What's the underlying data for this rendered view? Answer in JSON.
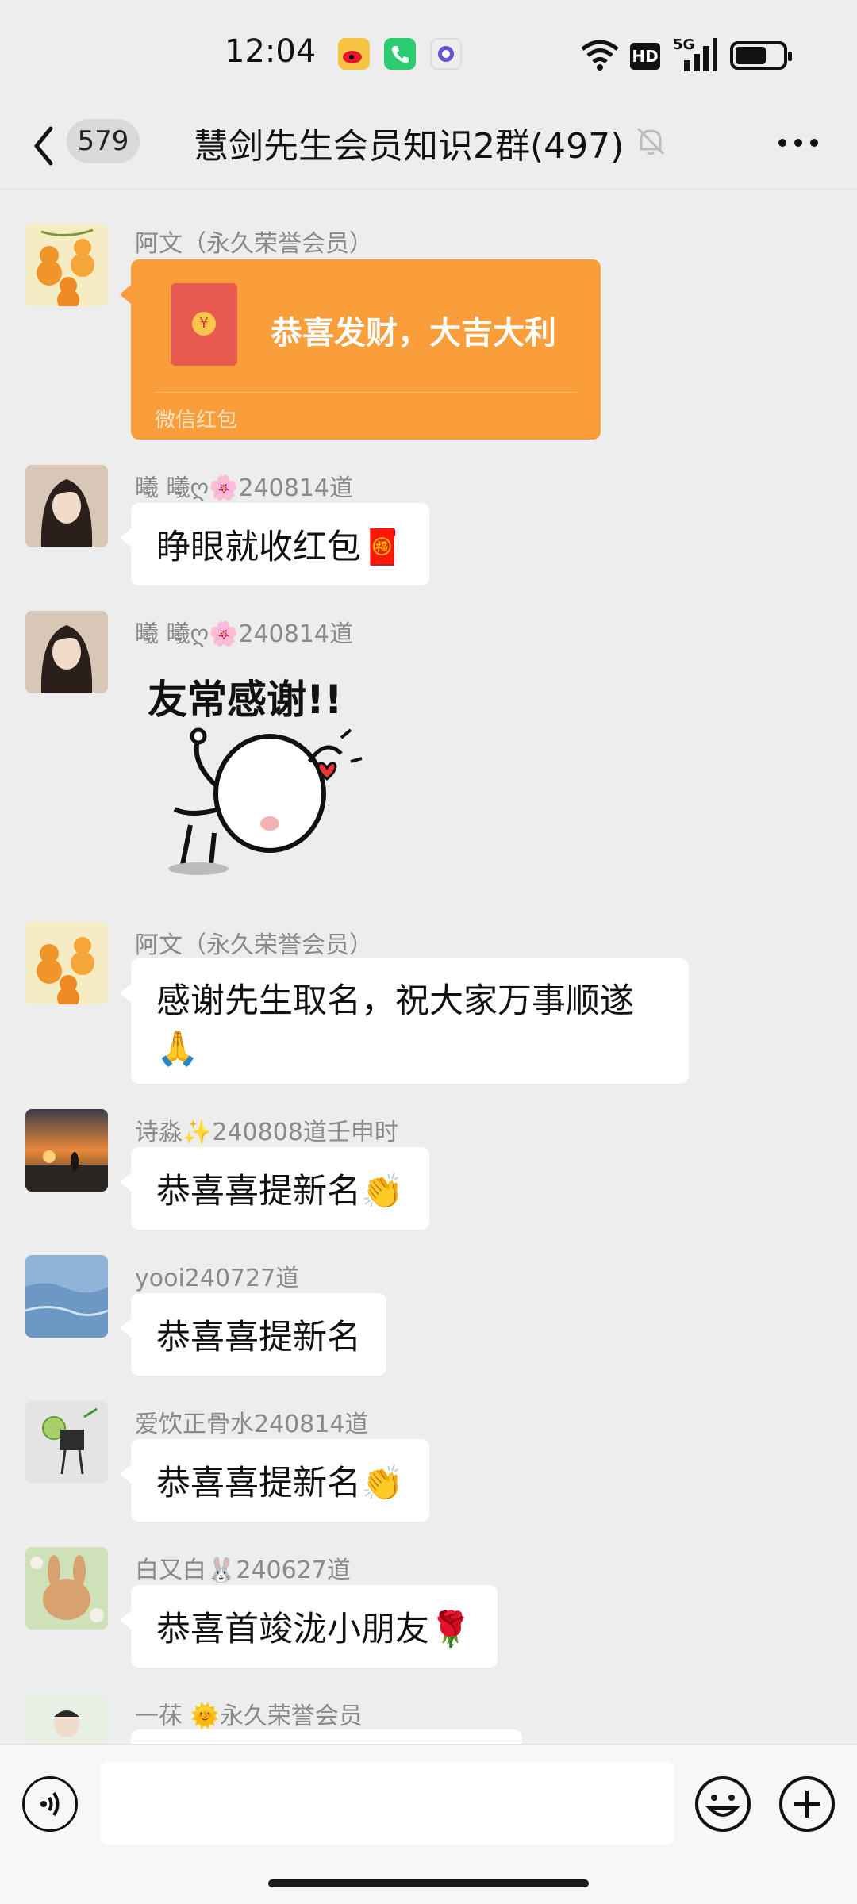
{
  "status_bar": {
    "time": "12:04",
    "apps": [
      "weibo-icon",
      "phone-icon",
      "app-icon"
    ],
    "indicators": [
      "wifi-icon",
      "HD",
      "5G",
      "battery-icon"
    ],
    "hd": "HD",
    "net": "5G"
  },
  "header": {
    "back_badge": "579",
    "title": "慧剑先生会员知识2群(497)"
  },
  "messages": [
    {
      "sender": "阿文（永久荣誉会员）",
      "type": "red_packet",
      "title": "恭喜发财，大吉大利",
      "footer": "微信红包"
    },
    {
      "sender": "曦 曦ღ🌸240814道",
      "type": "text",
      "text": "睁眼就收红包🧧"
    },
    {
      "sender": "曦 曦ღ🌸240814道",
      "type": "sticker",
      "text": "友常感谢!!"
    },
    {
      "sender": "阿文（永久荣誉会员）",
      "type": "text",
      "text": "感谢先生取名，祝大家万事顺遂🙏"
    },
    {
      "sender": "诗淼✨240808道壬申时",
      "type": "text",
      "text": "恭喜喜提新名👏"
    },
    {
      "sender": "yooi240727道",
      "type": "text",
      "text": "恭喜喜提新名"
    },
    {
      "sender": "爱饮正骨水240814道",
      "type": "text",
      "text": "恭喜喜提新名👏"
    },
    {
      "sender": "白又白🐰240627道",
      "type": "text",
      "text": "恭喜首竣泷小朋友🌹"
    },
    {
      "sender": "一茠 🌞永久荣誉会员",
      "type": "text",
      "text": ""
    }
  ],
  "colors": {
    "background": "#ededed",
    "bubble": "#ffffff",
    "red_packet": "#fa9d3b",
    "sender_text": "#8a8a8a"
  }
}
